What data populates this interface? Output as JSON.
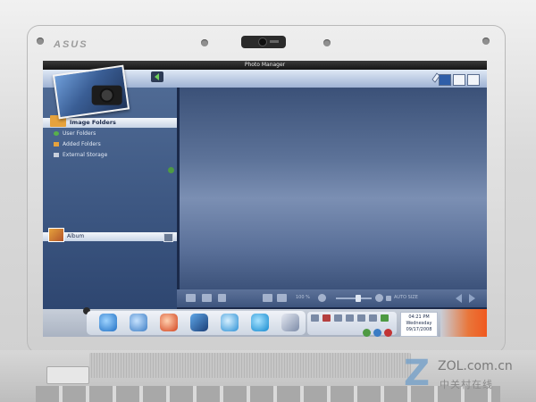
{
  "device": {
    "brand": "ASUS"
  },
  "window": {
    "title": "Photo Manager"
  },
  "sidebar": {
    "header": "Image Folders",
    "items": [
      {
        "label": "User Folders",
        "icon": "user-icon"
      },
      {
        "label": "Added Folders",
        "icon": "folder-icon"
      },
      {
        "label": "External Storage",
        "icon": "drive-icon"
      }
    ],
    "album": "Album"
  },
  "bottombar": {
    "zoom": "100 %",
    "auto": "AUTO SIZE"
  },
  "clock": {
    "time": "04:21 PM",
    "day": "Wednesday",
    "date": "09/17/2008"
  },
  "watermark": {
    "site": "ZOL.com.cn",
    "cn": "中关村在线"
  },
  "colors": {
    "accent": "#2f5ea8",
    "sidebar": "#3b5580",
    "content": "#5c7298",
    "taskbar": "#c7ced9",
    "orange": "#f0591f"
  }
}
